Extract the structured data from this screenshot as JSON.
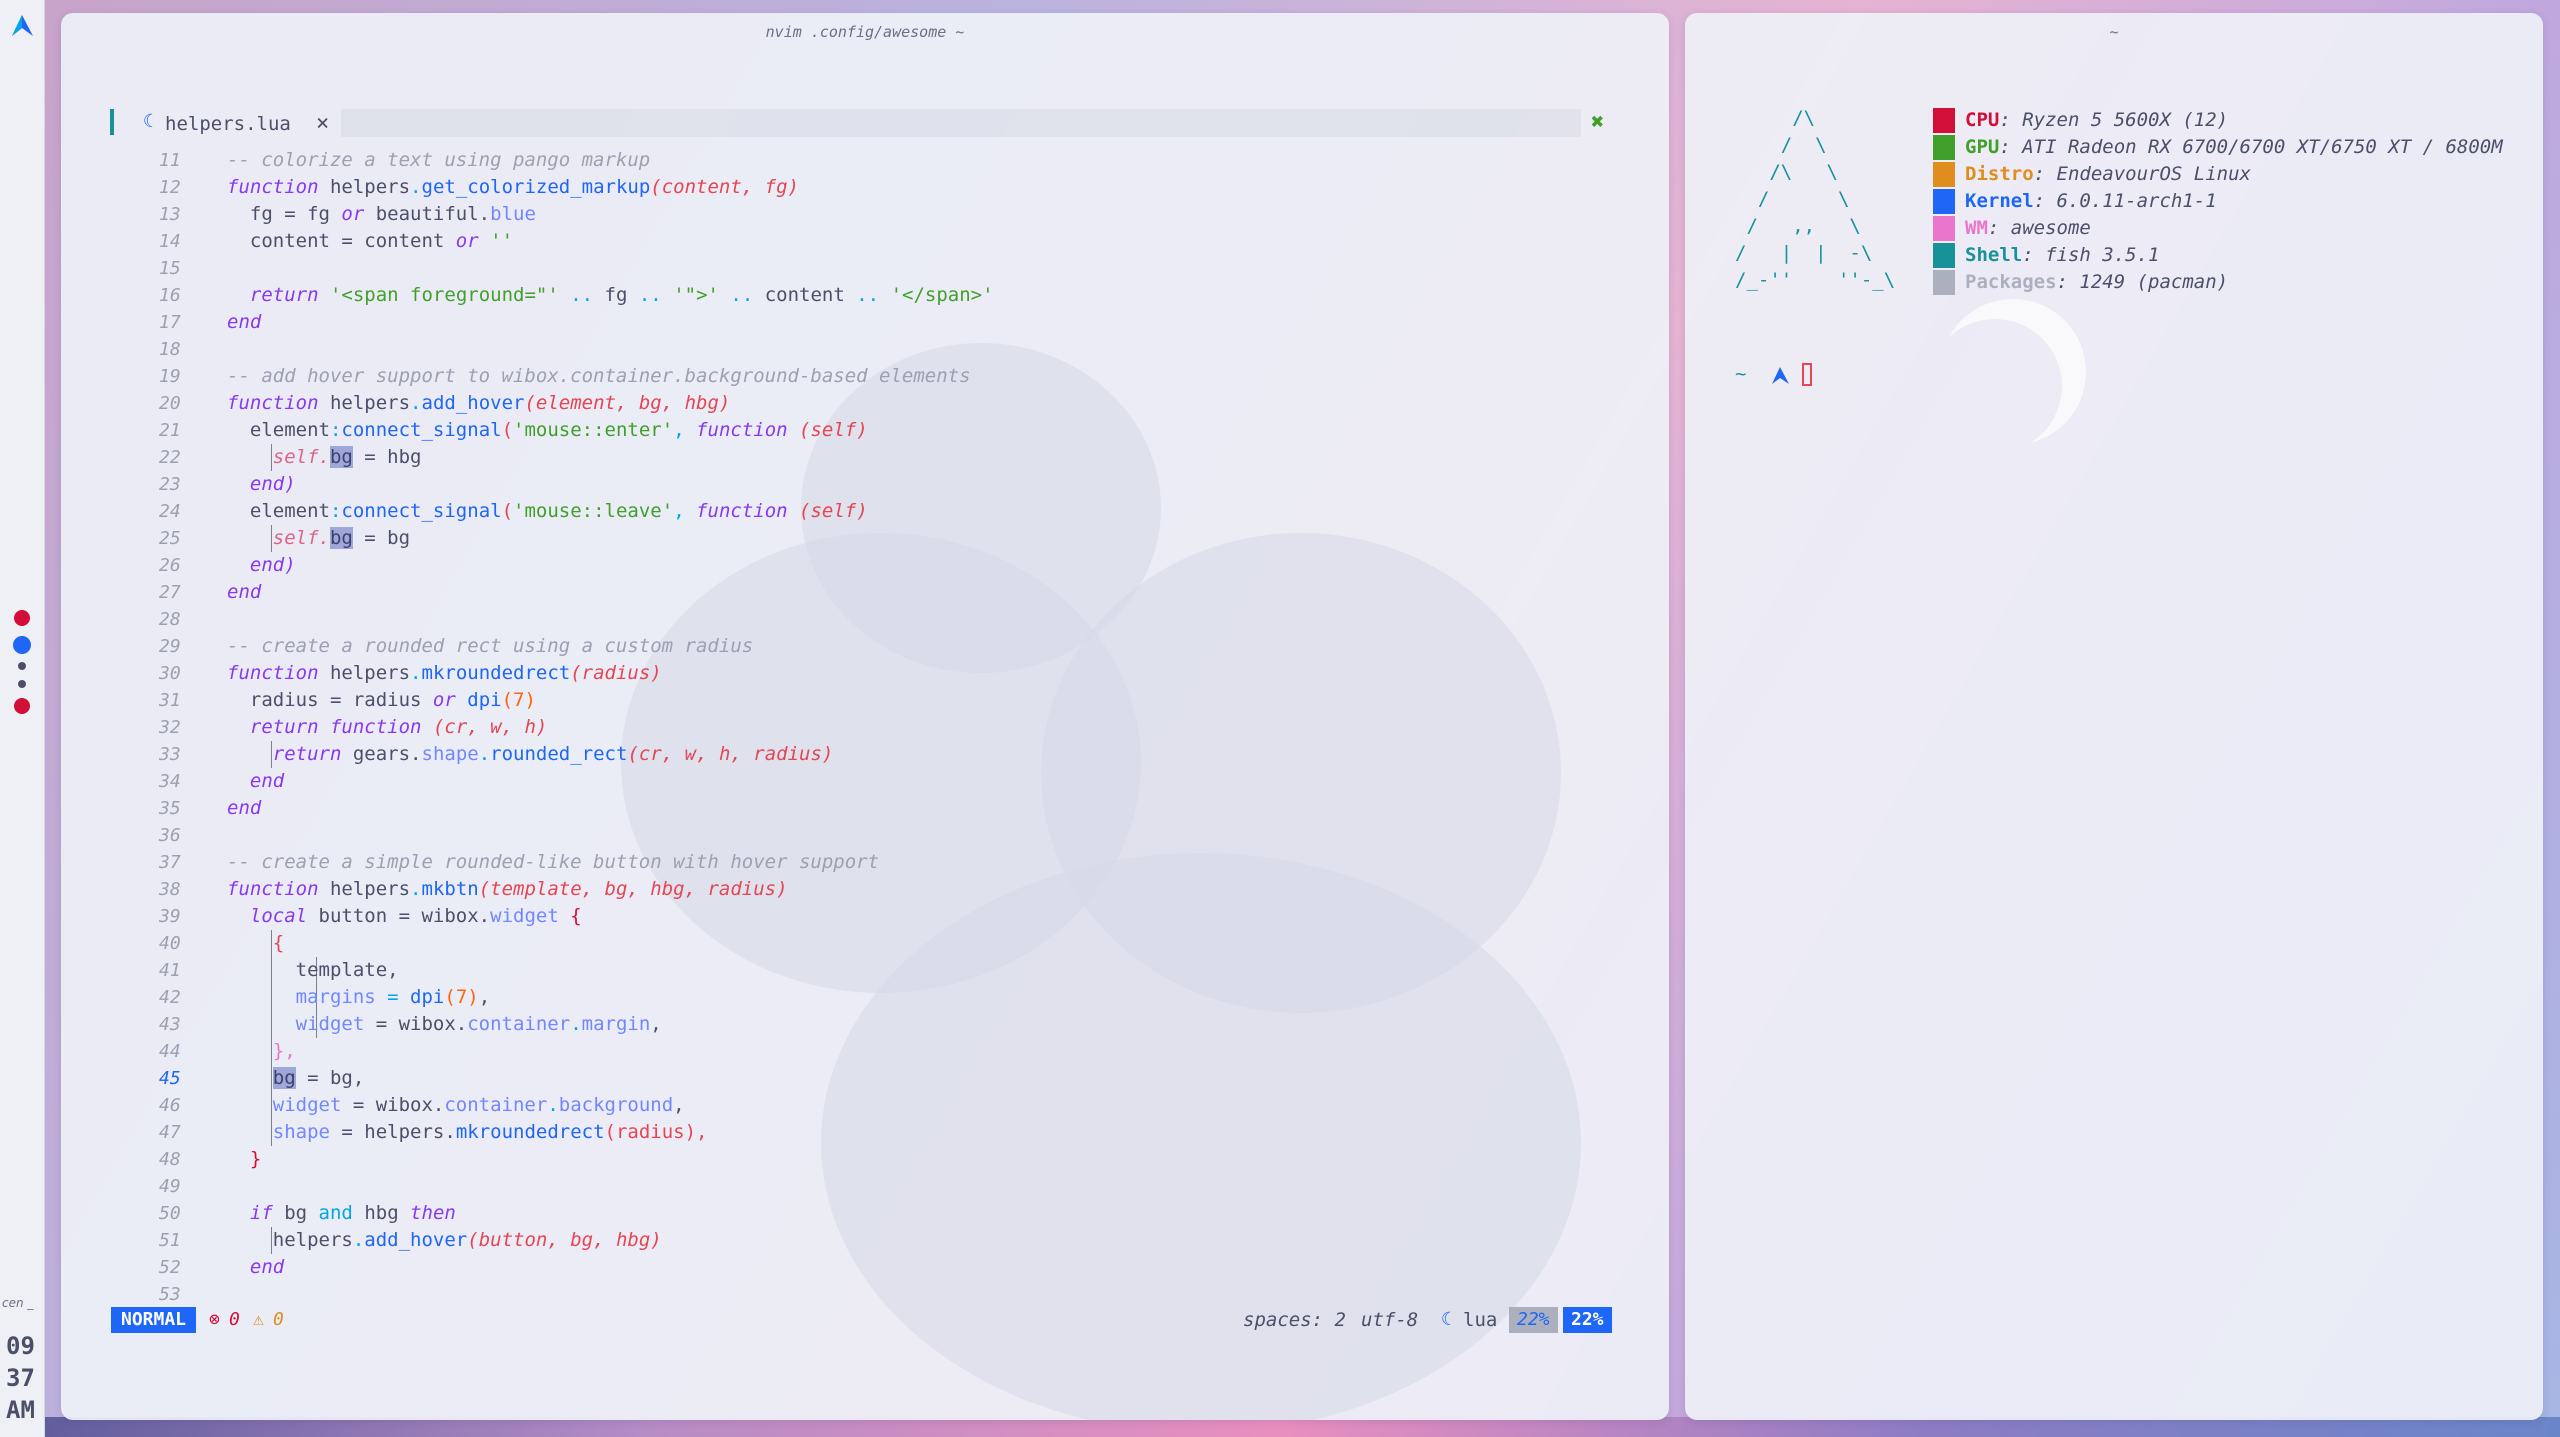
{
  "sidebar": {
    "tags": [
      {
        "color": "#d20f39"
      },
      {
        "color": "#1e66f5"
      },
      {
        "color": "#4c4f69"
      },
      {
        "color": "#4c4f69"
      },
      {
        "color": "#d20f39"
      }
    ],
    "clock_label": "cen _",
    "clock_hour": "09",
    "clock_min": "37",
    "clock_ampm": "AM"
  },
  "nvim": {
    "window_title": "nvim .config/awesome ~",
    "tab_name": "helpers.lua",
    "lines": [
      {
        "n": "11"
      },
      {
        "n": "12"
      },
      {
        "n": "13"
      },
      {
        "n": "14"
      },
      {
        "n": "15"
      },
      {
        "n": "16"
      },
      {
        "n": "17"
      },
      {
        "n": "18"
      },
      {
        "n": "19"
      },
      {
        "n": "20"
      },
      {
        "n": "21"
      },
      {
        "n": "22"
      },
      {
        "n": "23"
      },
      {
        "n": "24"
      },
      {
        "n": "25"
      },
      {
        "n": "26"
      },
      {
        "n": "27"
      },
      {
        "n": "28"
      },
      {
        "n": "29"
      },
      {
        "n": "30"
      },
      {
        "n": "31"
      },
      {
        "n": "32"
      },
      {
        "n": "33"
      },
      {
        "n": "34"
      },
      {
        "n": "35"
      },
      {
        "n": "36"
      },
      {
        "n": "37"
      },
      {
        "n": "38"
      },
      {
        "n": "39"
      },
      {
        "n": "40"
      },
      {
        "n": "41"
      },
      {
        "n": "42"
      },
      {
        "n": "43"
      },
      {
        "n": "44"
      },
      {
        "n": "45"
      },
      {
        "n": "46"
      },
      {
        "n": "47"
      },
      {
        "n": "48"
      },
      {
        "n": "49"
      },
      {
        "n": "50"
      },
      {
        "n": "51"
      },
      {
        "n": "52"
      },
      {
        "n": "53"
      }
    ],
    "code": {
      "l11": "-- colorize a text using pango markup",
      "kw_function": "function",
      "kw_end": "end",
      "kw_return": "return",
      "kw_or": "or",
      "kw_local": "local",
      "kw_if": "if",
      "kw_and": "and",
      "kw_then": "then",
      "helpers": "helpers",
      "fn_colorize": "get_colorized_markup",
      "p_content_fg": "(content, fg)",
      "l13_a": "fg = fg ",
      "l13_b": " beautiful.",
      "l13_c": "blue",
      "l14_a": "content = content ",
      "l14_b": " ''",
      "l16_s1": "'<span foreground=\"'",
      "l16_op1": " .. ",
      "l16_fg": "fg",
      "l16_s2": "'\">'",
      "l16_content": "content",
      "l16_s3": "'</span>'",
      "l19": "-- add hover support to wibox.container.background-based elements",
      "fn_add_hover": "add_hover",
      "p_add_hover": "(element, bg, hbg)",
      "element": "element",
      "connect_signal": "connect_signal",
      "s_enter": "'mouse::enter'",
      "s_leave": "'mouse::leave'",
      "p_self": "(self)",
      "self": "self.",
      "bg": "bg",
      "eq_hbg": " = hbg",
      "eq_bg": " = bg",
      "end_paren": "end)",
      "l29": "-- create a rounded rect using a custom radius",
      "fn_mkroundedrect": "mkroundedrect",
      "p_radius": "(radius)",
      "l31_a": "radius = radius ",
      "dpi": "dpi",
      "seven": "(7)",
      "p_cr": "(cr, w, h)",
      "gears": "gears.",
      "shape": "shape",
      "rounded_rect": "rounded_rect",
      "args_rr": "(cr, w, h, radius)",
      "l37": "-- create a simple rounded-like button with hover support",
      "fn_mkbtn": "mkbtn",
      "p_mkbtn": "(template, bg, hbg, radius)",
      "button_eq": " button = wibox.",
      "widget_fld": "widget",
      "brace_open": "{",
      "template": "template,",
      "margins": "margins",
      "widget_eq": "widget",
      "wibox_container": " = wibox.",
      "container": "container",
      "margin_fld": "margin",
      "brace_close_comma": "},",
      "bg_eq_bg": " = bg,",
      "background_fld": "background",
      "shape_fld": "shape",
      "helpers_mk": " = helpers.",
      "radius_arg": "(radius),",
      "brace_close": "}",
      "l50_mid": " bg ",
      "l50_hbg": " hbg ",
      "add_hover_call": "add_hover",
      "args_hover": "(button, bg, hbg)"
    },
    "status": {
      "mode": "NORMAL",
      "errors": "0",
      "warnings": "0",
      "indent": "spaces: 2",
      "encoding": "utf-8",
      "filetype": "lua",
      "percent_a": "22%",
      "percent_b": "22%"
    }
  },
  "terminal": {
    "window_title": "~",
    "logo_lines": [
      "     /\\",
      "    /  \\",
      "   /\\   \\",
      "  /      \\",
      " /   ,,   \\",
      "/   |  |  -\\",
      "/_-''    ''-_\\"
    ],
    "info": [
      {
        "key": "CPU",
        "value": "Ryzen 5 5600X (12)",
        "color": "#d20f39"
      },
      {
        "key": "GPU",
        "value": "ATI Radeon RX 6700/6700 XT/6750 XT / 6800M",
        "color": "#40a02b"
      },
      {
        "key": "Distro",
        "value": "EndeavourOS Linux",
        "color": "#df8e1d"
      },
      {
        "key": "Kernel",
        "value": "6.0.11-arch1-1",
        "color": "#1e66f5"
      },
      {
        "key": "WM",
        "value": "awesome",
        "color": "#ea76cb"
      },
      {
        "key": "Shell",
        "value": "fish 3.5.1",
        "color": "#179299"
      },
      {
        "key": "Packages",
        "value": "1249 (pacman)",
        "color": "#acb0be"
      }
    ],
    "prompt": "~"
  }
}
